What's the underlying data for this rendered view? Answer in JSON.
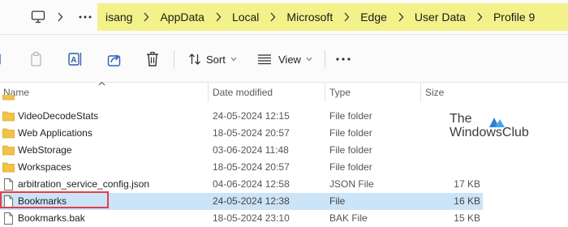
{
  "address_bar": {
    "icons": [
      "computer-icon",
      "chevron-right-icon",
      "more-icon"
    ],
    "breadcrumbs": [
      "isang",
      "AppData",
      "Local",
      "Microsoft",
      "Edge",
      "User Data",
      "Profile 9"
    ]
  },
  "toolbar": {
    "sort_label": "Sort",
    "view_label": "View",
    "icons": [
      "cut-icon",
      "copy-icon",
      "rename-icon",
      "share-icon",
      "delete-icon",
      "sort-icon",
      "view-icon",
      "more-icon"
    ]
  },
  "columns": {
    "name": "Name",
    "date_modified": "Date modified",
    "type": "Type",
    "size": "Size"
  },
  "rows": [
    {
      "name": "",
      "date": "",
      "type": "",
      "size": "",
      "kind": "folder",
      "partial": true
    },
    {
      "name": "VideoDecodeStats",
      "date": "24-05-2024 12:15",
      "type": "File folder",
      "size": "",
      "kind": "folder"
    },
    {
      "name": "Web Applications",
      "date": "18-05-2024 20:57",
      "type": "File folder",
      "size": "",
      "kind": "folder"
    },
    {
      "name": "WebStorage",
      "date": "03-06-2024 11:48",
      "type": "File folder",
      "size": "",
      "kind": "folder"
    },
    {
      "name": "Workspaces",
      "date": "18-05-2024 20:57",
      "type": "File folder",
      "size": "",
      "kind": "folder"
    },
    {
      "name": "arbitration_service_config.json",
      "date": "04-06-2024 12:58",
      "type": "JSON File",
      "size": "17 KB",
      "kind": "file"
    },
    {
      "name": "Bookmarks",
      "date": "24-05-2024 12:38",
      "type": "File",
      "size": "16 KB",
      "kind": "file",
      "selected": true
    },
    {
      "name": "Bookmarks.bak",
      "date": "18-05-2024 23:10",
      "type": "BAK File",
      "size": "15 KB",
      "kind": "file"
    }
  ],
  "watermark": {
    "line1": "The",
    "line2": "WindowsClub"
  },
  "colors": {
    "breadcrumb_highlight": "#f3f28a",
    "selection": "#cce4f7",
    "folder": "#f3c246",
    "highlight_box": "#e0404a"
  }
}
